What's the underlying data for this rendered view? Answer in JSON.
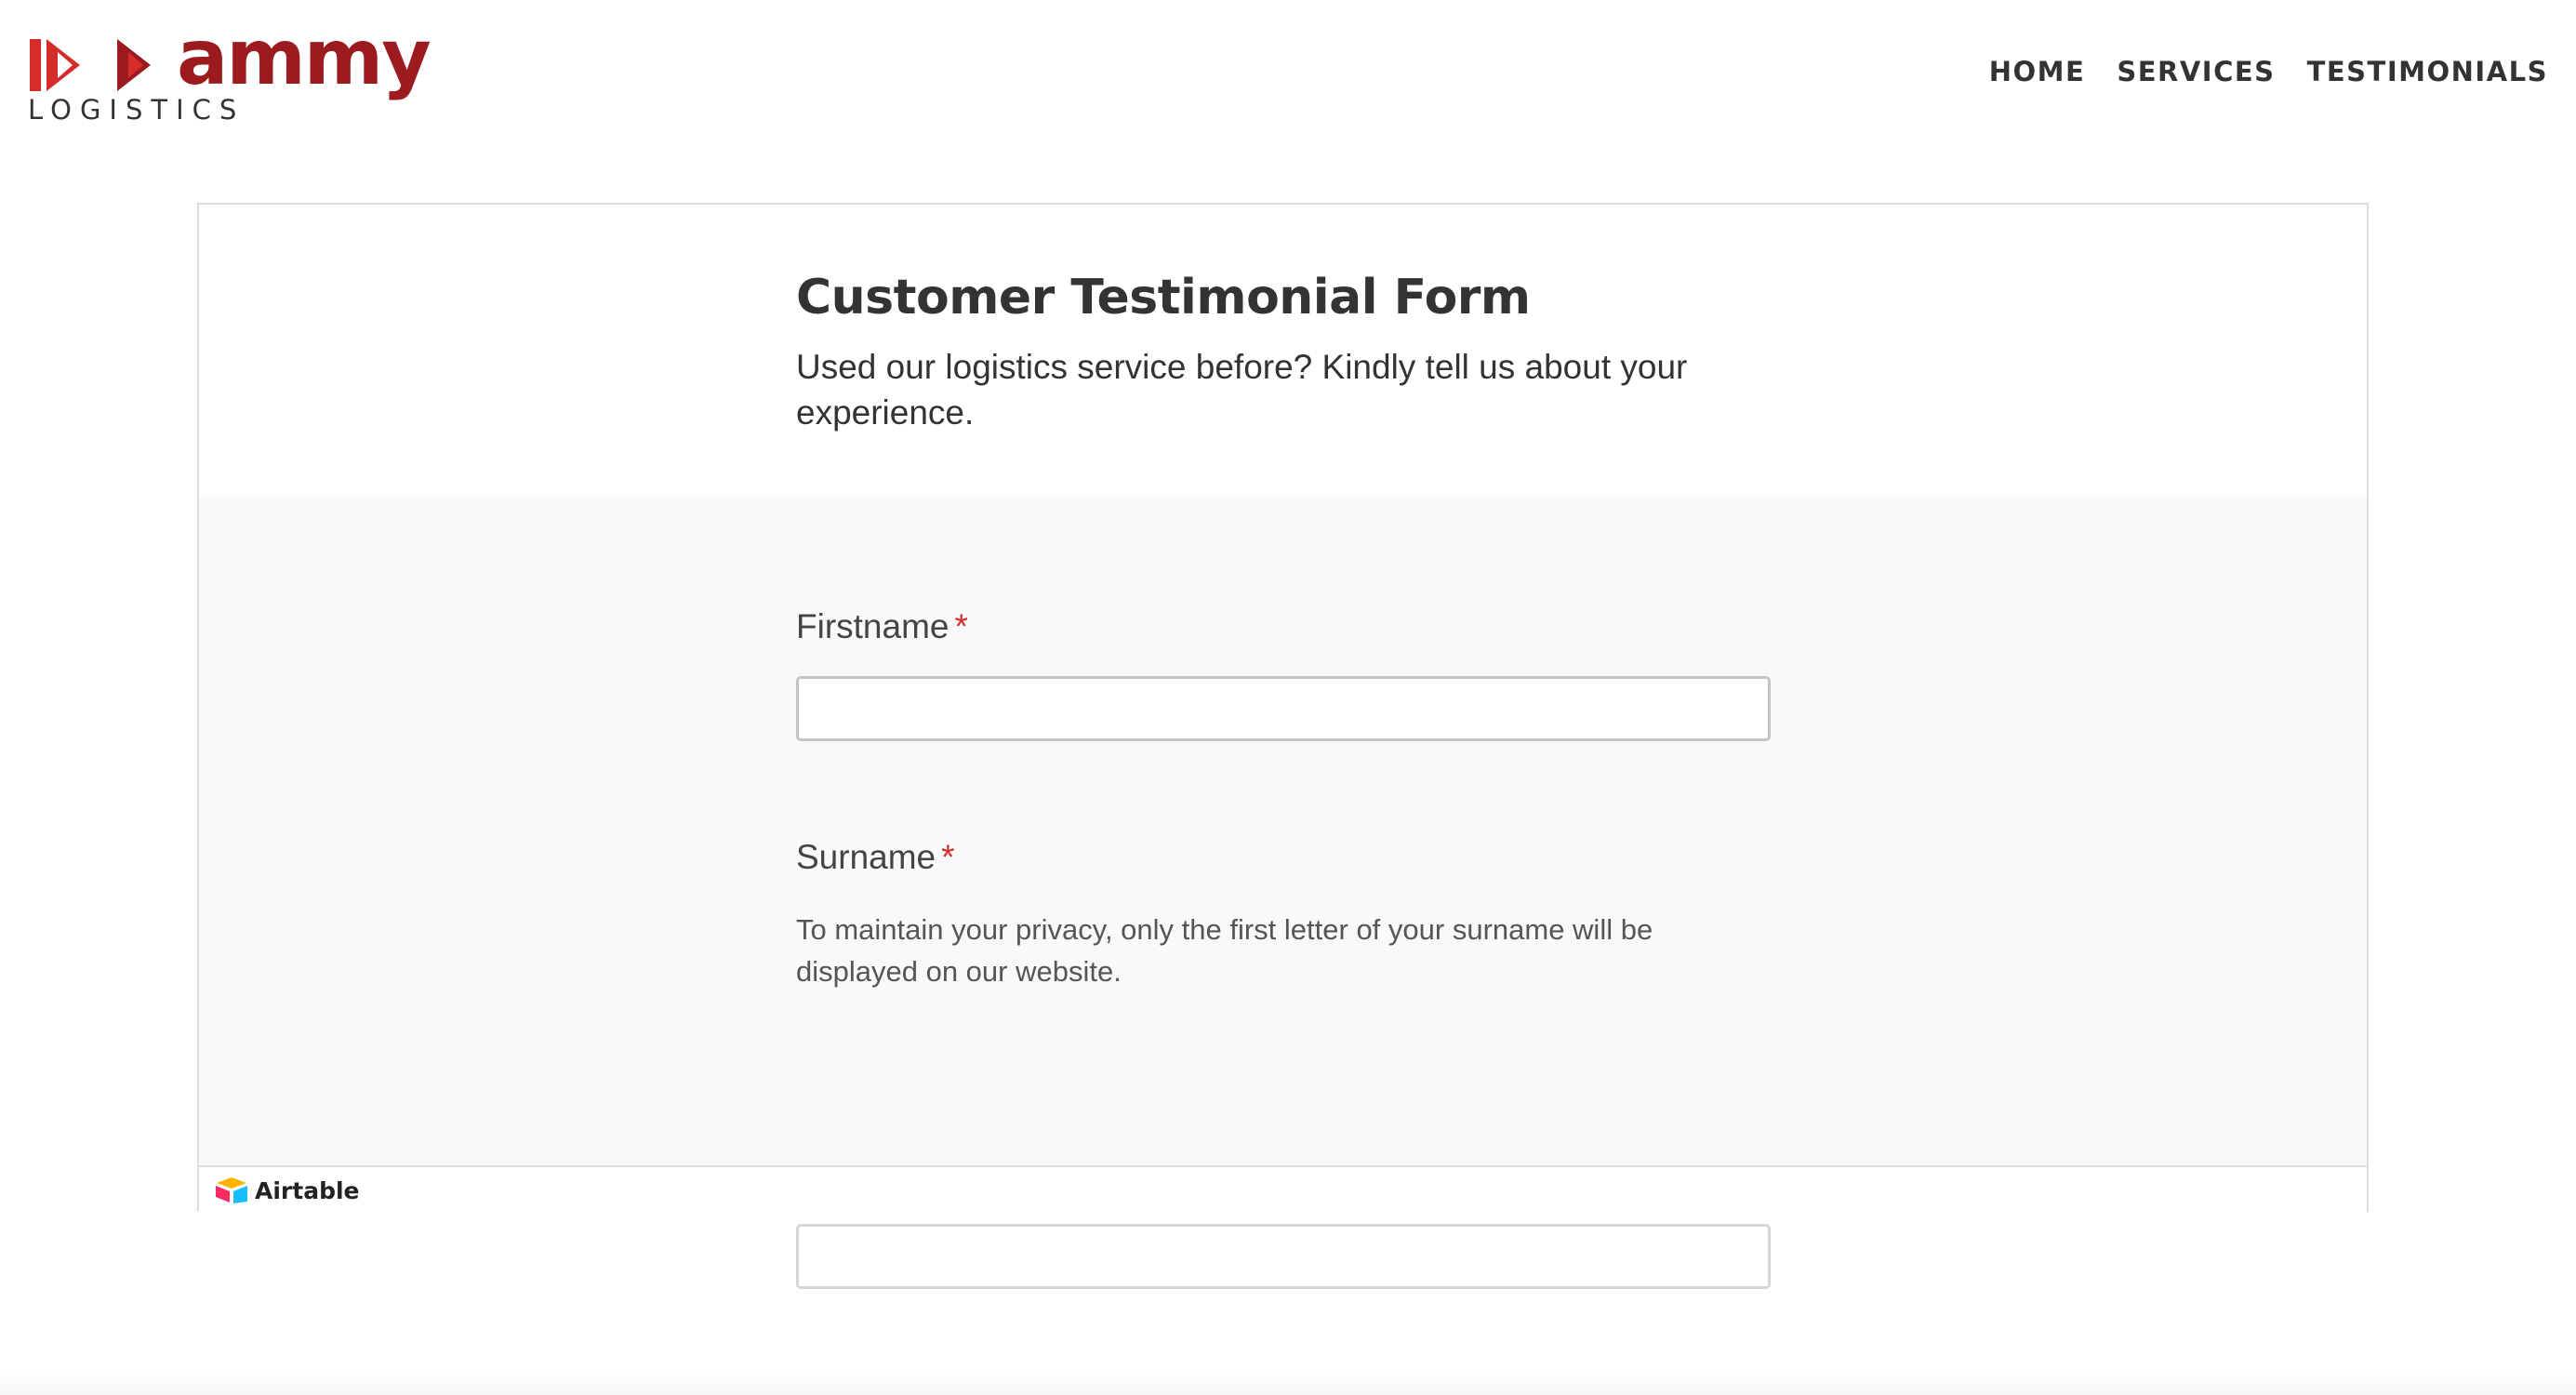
{
  "brand": {
    "name": "ammy",
    "tagline": "LOGISTICS",
    "primary_color": "#9b1b1f",
    "accent_color": "#d62b2b"
  },
  "nav": {
    "items": [
      {
        "label": "HOME"
      },
      {
        "label": "SERVICES"
      },
      {
        "label": "TESTIMONIALS"
      }
    ]
  },
  "form": {
    "title": "Customer Testimonial Form",
    "description": "Used our logistics service before? Kindly tell us about your experience.",
    "fields": {
      "firstname": {
        "label": "Firstname",
        "required_mark": "*",
        "value": ""
      },
      "surname": {
        "label": "Surname",
        "required_mark": "*",
        "help": "To maintain your privacy, only the first letter of your surname will be displayed on our website.",
        "value": ""
      }
    },
    "required_color": "#d22d2d"
  },
  "footer": {
    "brand_label": "Airtable",
    "icon": "airtable-logo-icon"
  }
}
